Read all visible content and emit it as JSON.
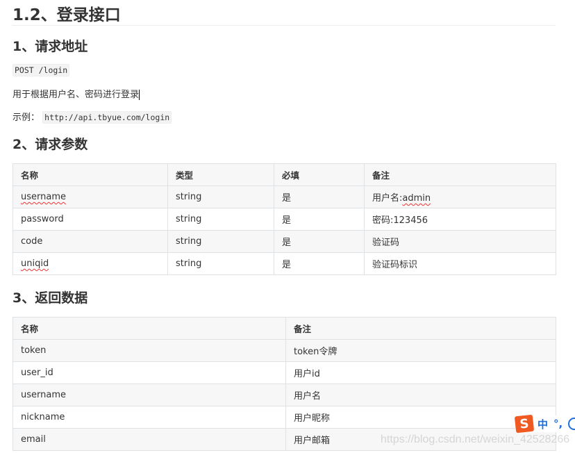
{
  "title": "1.2、登录接口",
  "sections": [
    {
      "heading": "1、请求地址",
      "code": "POST /login",
      "desc": "用于根据用户名、密码进行登录",
      "example_label": "示例：",
      "example_url": "http://api.tbyue.com/login"
    },
    {
      "heading": "2、请求参数"
    },
    {
      "heading": "3、返回数据"
    }
  ],
  "params_table": {
    "headers": [
      "名称",
      "类型",
      "必填",
      "备注"
    ],
    "rows": [
      [
        "username",
        "string",
        "是",
        "用户名:admin"
      ],
      [
        "password",
        "string",
        "是",
        "密码:123456"
      ],
      [
        "code",
        "string",
        "是",
        "验证码"
      ],
      [
        "uniqid",
        "string",
        "是",
        "验证码标识"
      ]
    ]
  },
  "return_table": {
    "headers": [
      "名称",
      "备注"
    ],
    "rows": [
      [
        "token",
        "token令牌"
      ],
      [
        "user_id",
        "用户id"
      ],
      [
        "username",
        "用户名"
      ],
      [
        "nickname",
        "用户昵称"
      ],
      [
        "email",
        "用户邮箱"
      ]
    ]
  },
  "watermark": "https://blog.csdn.net/weixin_42528266",
  "ime": {
    "logo": "S",
    "mode": "中",
    "punct": "°,",
    "icon": "smiley-icon"
  }
}
